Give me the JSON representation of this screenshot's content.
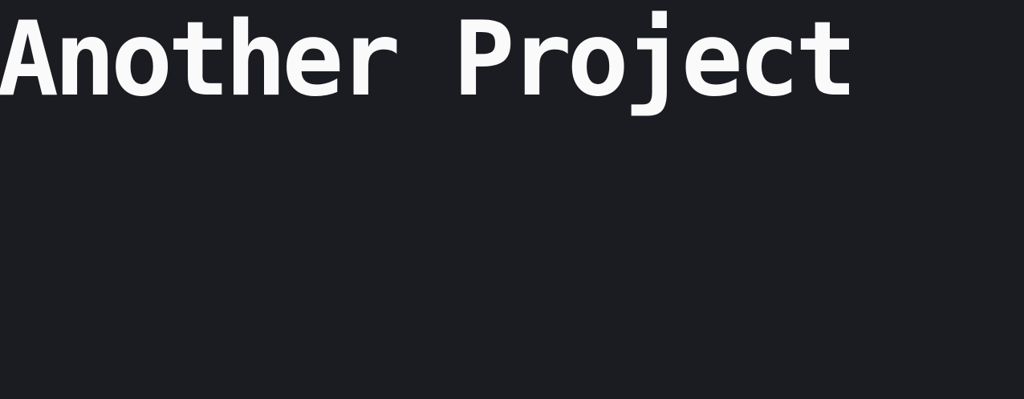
{
  "page": {
    "title": "Another Project"
  },
  "colors": {
    "background": "#1b1c21",
    "text": "#fafafa"
  }
}
